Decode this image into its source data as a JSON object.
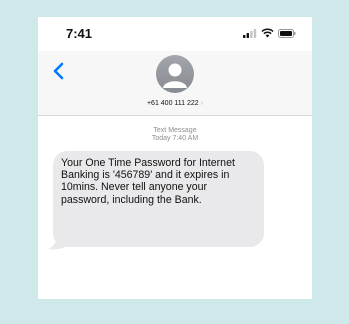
{
  "status": {
    "time": "7:41",
    "icons": [
      "cellular-signal-icon",
      "wifi-icon",
      "battery-icon"
    ]
  },
  "header": {
    "back_icon": "chevron-left-icon",
    "avatar_icon": "person-icon",
    "contact_number": "+61 400 111 222",
    "contact_chevron": "›"
  },
  "conversation": {
    "meta_title": "Text Message",
    "meta_time": "Today 7:40 AM",
    "message": "Your One Time Password for Internet Banking is '456789' and it expires in 10mins. Never tell anyone your password, including the Bank."
  },
  "colors": {
    "background": "#cfe8ea",
    "accent": "#007aff",
    "bubble": "#e9e9eb"
  }
}
